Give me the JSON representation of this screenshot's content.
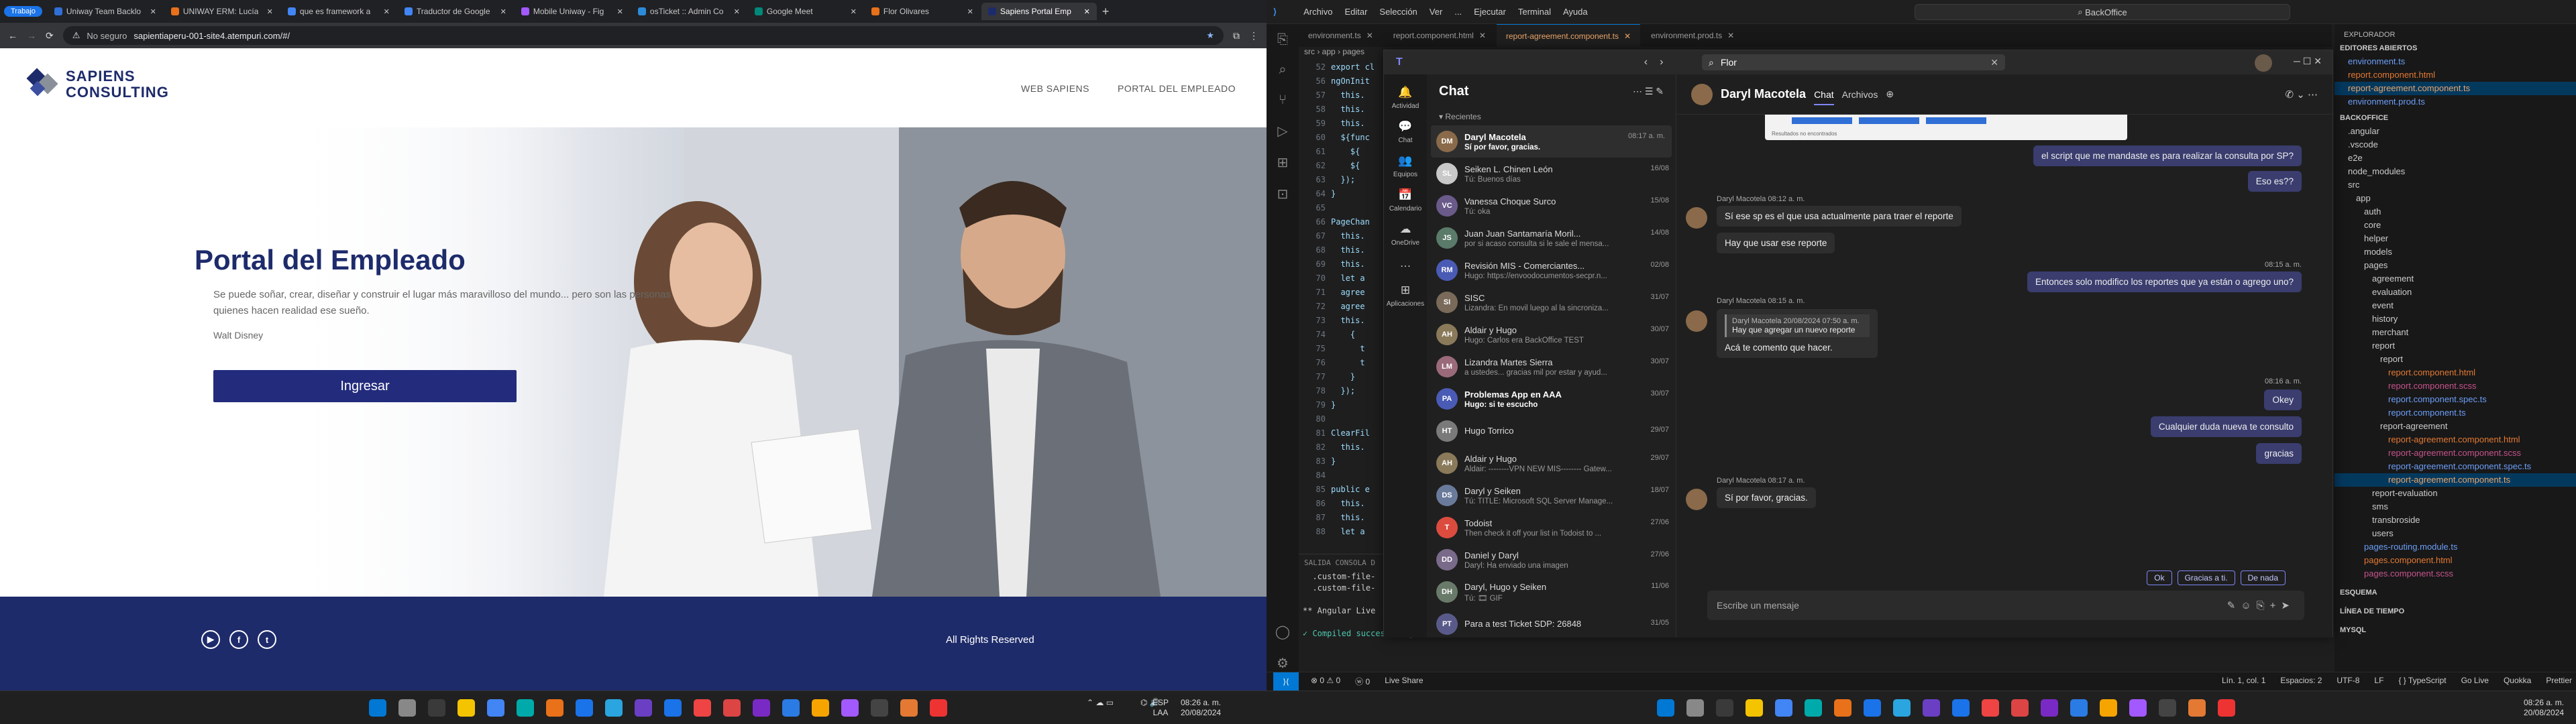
{
  "browser": {
    "profile": "Trabajo",
    "tabs": [
      {
        "title": "Uniway Team Backlo",
        "color": "#2f6fd6"
      },
      {
        "title": "UNIWAY ERM: Lucía",
        "color": "#e8711a"
      },
      {
        "title": "que es framework a",
        "color": "#4285f4"
      },
      {
        "title": "Traductor de Google",
        "color": "#4285f4"
      },
      {
        "title": "Mobile Uniway - Fig",
        "color": "#a259ff"
      },
      {
        "title": "osTicket :: Admin Co",
        "color": "#2c8bd8"
      },
      {
        "title": "Google Meet",
        "color": "#00897b"
      },
      {
        "title": "Flor Olivares",
        "color": "#e8711a"
      },
      {
        "title": "Sapiens Portal Emp",
        "color": "#1e2b6b"
      }
    ],
    "address_security": "No seguro",
    "address_url": "sapientiaperu-001-site4.atempuri.com/#/"
  },
  "site": {
    "logo_line1": "SAPIENS",
    "logo_line2": "CONSULTING",
    "nav": [
      "WEB SAPIENS",
      "PORTAL DEL EMPLEADO"
    ],
    "title": "Portal del Empleado",
    "quote": "Se puede soñar, crear, diseñar y construir el lugar más maravilloso del mundo... pero son las personas quienes hacen realidad ese sueño.",
    "author": "Walt Disney",
    "cta": "Ingresar",
    "footer_rights": "All Rights Reserved",
    "social_icons": [
      "youtube-icon",
      "facebook-icon",
      "twitter-icon"
    ],
    "colors": {
      "brand": "#1e2b6b",
      "button": "#232c7c"
    }
  },
  "vscode": {
    "menu": [
      "Archivo",
      "Editar",
      "Selección",
      "Ver",
      "...",
      "Ejecutar",
      "Terminal",
      "Ayuda"
    ],
    "search": "BackOffice",
    "tabs": [
      {
        "label": "environment.ts",
        "active": false
      },
      {
        "label": "report.component.html",
        "active": false
      },
      {
        "label": "report-agreement.component.ts",
        "active": true
      },
      {
        "label": "environment.prod.ts",
        "active": false
      }
    ],
    "breadcrumb": "src › app › pages",
    "code_lines": [
      {
        "n": "52",
        "t": "export cl"
      },
      {
        "n": "56",
        "t": "ngOnInit"
      },
      {
        "n": "57",
        "t": "  this."
      },
      {
        "n": "58",
        "t": "  this."
      },
      {
        "n": "59",
        "t": "  this."
      },
      {
        "n": "60",
        "t": "  ${func"
      },
      {
        "n": "61",
        "t": "    ${"
      },
      {
        "n": "62",
        "t": "    ${"
      },
      {
        "n": "63",
        "t": "  });"
      },
      {
        "n": "64",
        "t": "}"
      },
      {
        "n": "65",
        "t": ""
      },
      {
        "n": "66",
        "t": "PageChan"
      },
      {
        "n": "67",
        "t": "  this."
      },
      {
        "n": "68",
        "t": "  this."
      },
      {
        "n": "69",
        "t": "  this."
      },
      {
        "n": "70",
        "t": "  let a"
      },
      {
        "n": "71",
        "t": "  agree"
      },
      {
        "n": "72",
        "t": "  agree"
      },
      {
        "n": "73",
        "t": "  this."
      },
      {
        "n": "74",
        "t": "    {"
      },
      {
        "n": "75",
        "t": "      t"
      },
      {
        "n": "76",
        "t": "      t"
      },
      {
        "n": "77",
        "t": "    }"
      },
      {
        "n": "78",
        "t": "  });"
      },
      {
        "n": "79",
        "t": "}"
      },
      {
        "n": "80",
        "t": ""
      },
      {
        "n": "81",
        "t": "ClearFil"
      },
      {
        "n": "82",
        "t": "  this."
      },
      {
        "n": "83",
        "t": "}"
      },
      {
        "n": "84",
        "t": ""
      },
      {
        "n": "85",
        "t": "public e"
      },
      {
        "n": "86",
        "t": "  this."
      },
      {
        "n": "87",
        "t": "  this."
      },
      {
        "n": "88",
        "t": "  let a"
      }
    ],
    "terminal_tabs": "SALIDA   CONSOLA D",
    "terminal_lines": [
      "  .custom-file-",
      "  .custom-file-",
      "",
      "** Angular Live",
      "",
      "✓ Compiled successfully."
    ],
    "explorer_title": "EXPLORADOR",
    "explorer_open": "EDITORES ABIERTOS",
    "explorer": [
      {
        "label": "environment.ts",
        "indent": 1,
        "color": "#6c9ef8"
      },
      {
        "label": "report.component.html",
        "indent": 1,
        "color": "#e37933"
      },
      {
        "label": "report-agreement.component.ts",
        "indent": 1,
        "color": "#e9a56a"
      },
      {
        "label": "environment.prod.ts",
        "indent": 1,
        "color": "#6c9ef8"
      },
      {
        "label": "BACKOFFICE",
        "indent": 0,
        "color": "#ccc"
      },
      {
        "label": ".angular",
        "indent": 1,
        "color": "#ccc"
      },
      {
        "label": ".vscode",
        "indent": 1,
        "color": "#ccc"
      },
      {
        "label": "e2e",
        "indent": 1,
        "color": "#ccc"
      },
      {
        "label": "node_modules",
        "indent": 1,
        "color": "#ccc"
      },
      {
        "label": "src",
        "indent": 1,
        "color": "#ccc"
      },
      {
        "label": "app",
        "indent": 2,
        "color": "#ccc"
      },
      {
        "label": "auth",
        "indent": 3,
        "color": "#ccc"
      },
      {
        "label": "core",
        "indent": 3,
        "color": "#ccc"
      },
      {
        "label": "helper",
        "indent": 3,
        "color": "#ccc"
      },
      {
        "label": "models",
        "indent": 3,
        "color": "#ccc"
      },
      {
        "label": "pages",
        "indent": 3,
        "color": "#ccc"
      },
      {
        "label": "agreement",
        "indent": 4,
        "color": "#ccc"
      },
      {
        "label": "evaluation",
        "indent": 4,
        "color": "#ccc"
      },
      {
        "label": "event",
        "indent": 4,
        "color": "#ccc"
      },
      {
        "label": "history",
        "indent": 4,
        "color": "#ccc"
      },
      {
        "label": "merchant",
        "indent": 4,
        "color": "#ccc"
      },
      {
        "label": "report",
        "indent": 4,
        "color": "#ccc"
      },
      {
        "label": "report",
        "indent": 5,
        "color": "#ccc"
      },
      {
        "label": "report.component.html",
        "indent": 6,
        "color": "#e37933"
      },
      {
        "label": "report.component.scss",
        "indent": 6,
        "color": "#c6538c"
      },
      {
        "label": "report.component.spec.ts",
        "indent": 6,
        "color": "#6c9ef8"
      },
      {
        "label": "report.component.ts",
        "indent": 6,
        "color": "#6c9ef8"
      },
      {
        "label": "report-agreement",
        "indent": 5,
        "color": "#ccc"
      },
      {
        "label": "report-agreement.component.html",
        "indent": 6,
        "color": "#e37933"
      },
      {
        "label": "report-agreement.component.scss",
        "indent": 6,
        "color": "#c6538c"
      },
      {
        "label": "report-agreement.component.spec.ts",
        "indent": 6,
        "color": "#6c9ef8"
      },
      {
        "label": "report-agreement.component.ts",
        "indent": 6,
        "color": "#e9a56a"
      },
      {
        "label": "report-evaluation",
        "indent": 4,
        "color": "#ccc"
      },
      {
        "label": "sms",
        "indent": 4,
        "color": "#ccc"
      },
      {
        "label": "transbroside",
        "indent": 4,
        "color": "#ccc"
      },
      {
        "label": "users",
        "indent": 4,
        "color": "#ccc"
      },
      {
        "label": "pages-routing.module.ts",
        "indent": 3,
        "color": "#6c9ef8"
      },
      {
        "label": "pages.component.html",
        "indent": 3,
        "color": "#e37933"
      },
      {
        "label": "pages.component.scss",
        "indent": 3,
        "color": "#c6538c"
      },
      {
        "label": "ESQUEMA",
        "indent": 0,
        "color": "#ccc"
      },
      {
        "label": "LÍNEA DE TIEMPO",
        "indent": 0,
        "color": "#ccc"
      },
      {
        "label": "MYSQL",
        "indent": 0,
        "color": "#ccc"
      }
    ],
    "status": [
      "⊗ 0 ⚠ 0",
      "ⓦ 0",
      "Live Share",
      "Lín. 1, col. 1",
      "Espacios: 2",
      "UTF-8",
      "LF",
      "{ } TypeScript",
      "Go Live",
      "Quokka",
      "Prettier"
    ]
  },
  "teams": {
    "search": "Flor",
    "list_title": "Chat",
    "recent_label": "Recientes",
    "rail": [
      {
        "label": "Actividad",
        "icon": "bell-icon",
        "glyph": "🔔"
      },
      {
        "label": "Chat",
        "icon": "chat-icon",
        "glyph": "💬"
      },
      {
        "label": "Equipos",
        "icon": "teams-icon",
        "glyph": "👥"
      },
      {
        "label": "Calendario",
        "icon": "calendar-icon",
        "glyph": "📅"
      },
      {
        "label": "OneDrive",
        "icon": "cloud-icon",
        "glyph": "☁"
      },
      {
        "label": "",
        "icon": "more-icon",
        "glyph": "…"
      },
      {
        "label": "Aplicaciones",
        "icon": "apps-icon",
        "glyph": "⊞"
      }
    ],
    "chats": [
      {
        "name": "Daryl Macotela",
        "date": "08:17 a. m.",
        "preview": "Sí por favor, gracias.",
        "color": "#8a6a4a",
        "initials": "DM",
        "selected": true,
        "unread": true
      },
      {
        "name": "Seiken L. Chinen León",
        "date": "16/08",
        "preview": "Tú: Buenos días",
        "color": "#c8c8c8",
        "initials": "SL",
        "selected": false,
        "unread": false
      },
      {
        "name": "Vanessa Choque Surco",
        "date": "15/08",
        "preview": "Tú: oka",
        "color": "#6a5a8a",
        "initials": "VC",
        "selected": false,
        "unread": false
      },
      {
        "name": "Juan Juan Santamaría Moril...",
        "date": "14/08",
        "preview": "por si acaso consulta si le sale el mensa...",
        "color": "#5a7a6a",
        "initials": "JS",
        "selected": false,
        "unread": false
      },
      {
        "name": "Revisión MIS - Comerciantes...",
        "date": "02/08",
        "preview": "Hugo: https://envoodocumentos-secpr.n...",
        "color": "#4a5bb5",
        "initials": "RM",
        "selected": false,
        "unread": false
      },
      {
        "name": "SISC",
        "date": "31/07",
        "preview": "Lizandra: En movil luego al la sincroniza...",
        "color": "#7a6a5a",
        "initials": "SI",
        "selected": false,
        "unread": false
      },
      {
        "name": "Aldair y Hugo",
        "date": "30/07",
        "preview": "Hugo: Carlos era BackOffice TEST",
        "color": "#8a7a5a",
        "initials": "AH",
        "selected": false,
        "unread": false
      },
      {
        "name": "Lizandra Martes Sierra",
        "date": "30/07",
        "preview": "a ustedes... gracias mil por estar y ayud...",
        "color": "#9a6a7a",
        "initials": "LM",
        "selected": false,
        "unread": false
      },
      {
        "name": "Problemas App en AAA",
        "date": "30/07",
        "preview": "Hugo: si te escucho",
        "color": "#4a5bb5",
        "initials": "PA",
        "selected": false,
        "unread": true
      },
      {
        "name": "Hugo Torrico",
        "date": "29/07",
        "preview": "",
        "color": "#7a7a7a",
        "initials": "HT",
        "selected": false,
        "unread": false
      },
      {
        "name": "Aldair y Hugo",
        "date": "29/07",
        "preview": "Aldair: --------VPN NEW MIS-------- Gatew...",
        "color": "#8a7a5a",
        "initials": "AH",
        "selected": false,
        "unread": false
      },
      {
        "name": "Daryl y Seiken",
        "date": "18/07",
        "preview": "Tú: TITLE: Microsoft SQL Server Manage...",
        "color": "#6a7a9a",
        "initials": "DS",
        "selected": false,
        "unread": false
      },
      {
        "name": "Todoist",
        "date": "27/06",
        "preview": "Then check it off your list in Todoist to ...",
        "color": "#db4c3f",
        "initials": "T",
        "selected": false,
        "unread": false
      },
      {
        "name": "Daniel y Daryl",
        "date": "27/06",
        "preview": "Daryl: Ha enviado una imagen",
        "color": "#7a6a8a",
        "initials": "DD",
        "selected": false,
        "unread": false
      },
      {
        "name": "Daryl, Hugo y Seiken",
        "date": "11/06",
        "preview": "Tú: 🎞 GIF",
        "color": "#6a7a6a",
        "initials": "DH",
        "selected": false,
        "unread": false
      },
      {
        "name": "Para a test Ticket SDP: 26848",
        "date": "31/05",
        "preview": "",
        "color": "#5a5a8a",
        "initials": "PT",
        "selected": false,
        "unread": false
      }
    ],
    "conv": {
      "name": "Daryl Macotela",
      "tabs": [
        "Chat",
        "Archivos"
      ],
      "image_caption": "Resultados no encontrados",
      "messages": [
        {
          "side": "me",
          "text": "el script que me mandaste es para realizar la consulta por SP?",
          "meta": ""
        },
        {
          "side": "me",
          "text": "Eso es??",
          "meta": ""
        },
        {
          "side": "them",
          "text": "Sí ese sp es el que usa actualmente para traer el reporte",
          "meta": "Daryl Macotela  08:12 a. m."
        },
        {
          "side": "them",
          "text": "Hay que usar ese reporte",
          "meta": ""
        },
        {
          "side": "me",
          "text": "Entonces solo modifico los reportes que ya están o agrego uno?",
          "meta": "08:15 a. m."
        },
        {
          "side": "them",
          "text": "Acá te comento que hacer.",
          "meta": "Daryl Macotela  08:15 a. m."
        },
        {
          "side": "me",
          "text": "Okey",
          "meta": "08:16 a. m."
        },
        {
          "side": "me",
          "text": "Cualquier duda nueva te consulto",
          "meta": ""
        },
        {
          "side": "me",
          "text": "gracias",
          "meta": ""
        },
        {
          "side": "them",
          "text": "Sí por favor, gracias.",
          "meta": "Daryl Macotela  08:17 a. m."
        }
      ],
      "quote_author": "Daryl Macotela 20/08/2024 07:50 a. m.",
      "quote_text": "Hay que agregar un nuevo reporte",
      "quick_replies": [
        "Ok",
        "Gracias a ti.",
        "De nada"
      ],
      "compose_placeholder": "Escribe un mensaje"
    }
  },
  "taskbar": {
    "lang": "ESP",
    "lang2": "LAA",
    "time_left": "08:26 a. m.",
    "date_left": "20/08/2024",
    "time_right": "08:26 a. m.",
    "date_right": "20/08/2024"
  }
}
